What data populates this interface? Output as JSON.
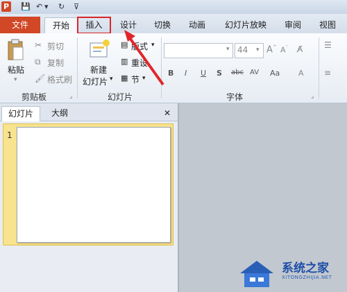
{
  "title_bar": {
    "app_icon": "P"
  },
  "file_tab": "文件",
  "tabs": [
    "开始",
    "插入",
    "设计",
    "切换",
    "动画",
    "幻灯片放映",
    "审阅",
    "视图"
  ],
  "clipboard": {
    "paste": "粘贴",
    "cut": "剪切",
    "copy": "复制",
    "format_painter": "格式刷",
    "group": "剪贴板"
  },
  "slides": {
    "new_slide_line1": "新建",
    "new_slide_line2": "幻灯片",
    "layout": "版式",
    "reset": "重设",
    "section": "节",
    "group": "幻灯片"
  },
  "font": {
    "size": "44",
    "group": "字体",
    "bold": "B",
    "italic": "I",
    "underline": "U",
    "strike": "abc",
    "spacing": "AV",
    "case": "Aa",
    "color": "A"
  },
  "panel": {
    "tab_slides": "幻灯片",
    "tab_outline": "大纲",
    "close": "✕",
    "slide_number": "1"
  },
  "watermark": {
    "name": "系统之家",
    "url": "XITONGZHIJIA.NET"
  },
  "colors": {
    "file_tab": "#d24726",
    "highlight": "#d8262b",
    "arrow": "#e0262b",
    "thumb_selected": "#f8e38e"
  }
}
